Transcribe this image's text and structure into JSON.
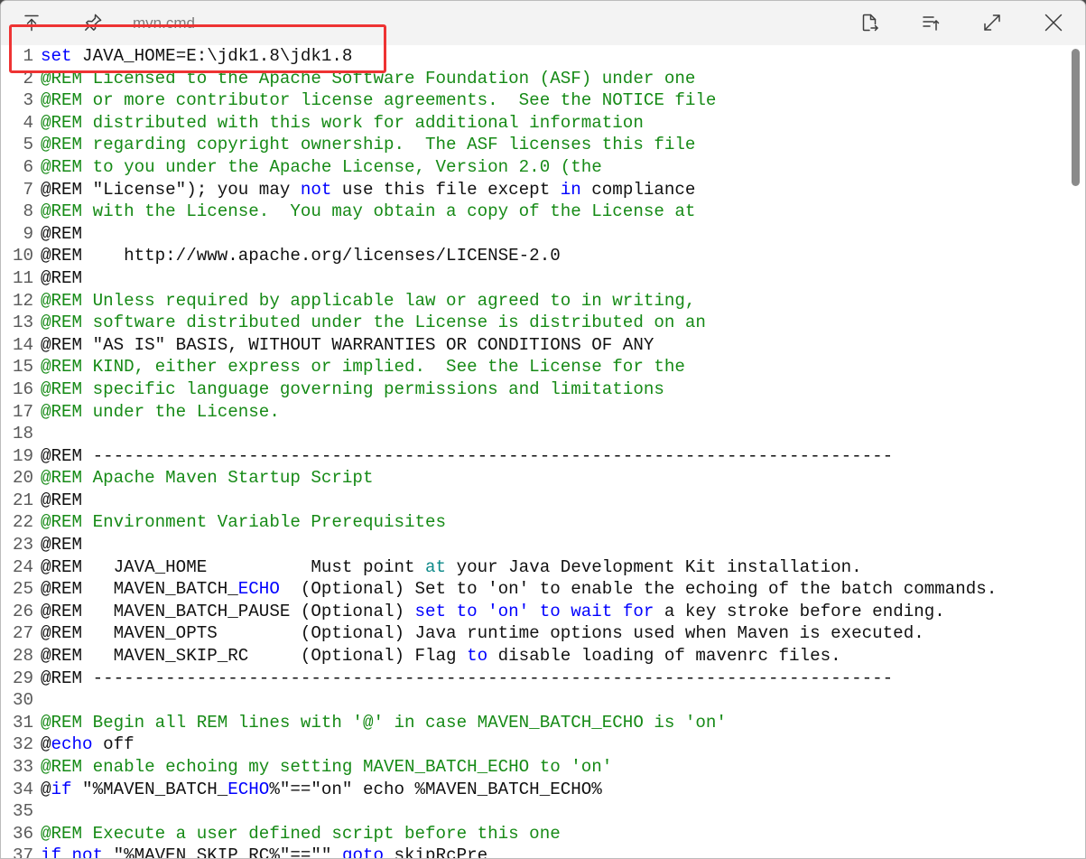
{
  "titlebar": {
    "title": "mvn.cmd",
    "left_icons": [
      "keep-on-top-icon",
      "pin-icon"
    ],
    "right_icons": [
      "open-with-icon",
      "list-icon",
      "fullscreen-icon",
      "close-icon"
    ]
  },
  "colors": {
    "keyword": "#0000ff",
    "comment": "#168a16",
    "label": "#0e8a8a",
    "text": "#111111",
    "line_number": "#5a5a5a",
    "annotation": "#ee3333"
  },
  "editor": {
    "scrollbar": {
      "position": 0,
      "visible_fraction": 0.17
    },
    "lines": [
      {
        "n": 1,
        "tokens": [
          {
            "t": "set",
            "k": "kw"
          },
          {
            "t": " JAVA_HOME=E:\\jdk1.8\\jdk1.8",
            "k": "tx"
          }
        ]
      },
      {
        "n": 2,
        "tokens": [
          {
            "t": "@REM Licensed to the Apache Software Foundation (ASF) under one",
            "k": "cm"
          }
        ]
      },
      {
        "n": 3,
        "tokens": [
          {
            "t": "@REM or more contributor license agreements.  See the NOTICE file",
            "k": "cm"
          }
        ]
      },
      {
        "n": 4,
        "tokens": [
          {
            "t": "@REM distributed with this work for additional information",
            "k": "cm"
          }
        ]
      },
      {
        "n": 5,
        "tokens": [
          {
            "t": "@REM regarding copyright ownership.  The ASF licenses this file",
            "k": "cm"
          }
        ]
      },
      {
        "n": 6,
        "tokens": [
          {
            "t": "@REM to you under the Apache License, Version 2.0 (the",
            "k": "cm"
          }
        ]
      },
      {
        "n": 7,
        "tokens": [
          {
            "t": "@REM \"License\"); you may ",
            "k": "tx"
          },
          {
            "t": "not",
            "k": "kw"
          },
          {
            "t": " use this file except ",
            "k": "tx"
          },
          {
            "t": "in",
            "k": "kw"
          },
          {
            "t": " compliance",
            "k": "tx"
          }
        ]
      },
      {
        "n": 8,
        "tokens": [
          {
            "t": "@REM with the License.  You may obtain a copy of the License at",
            "k": "cm"
          }
        ]
      },
      {
        "n": 9,
        "tokens": [
          {
            "t": "@REM",
            "k": "tx"
          }
        ]
      },
      {
        "n": 10,
        "tokens": [
          {
            "t": "@REM    http://www.apache.org/licenses/LICENSE-2.0",
            "k": "tx"
          }
        ]
      },
      {
        "n": 11,
        "tokens": [
          {
            "t": "@REM",
            "k": "tx"
          }
        ]
      },
      {
        "n": 12,
        "tokens": [
          {
            "t": "@REM Unless required by applicable law or agreed to in writing,",
            "k": "cm"
          }
        ]
      },
      {
        "n": 13,
        "tokens": [
          {
            "t": "@REM software distributed under the License is distributed on an",
            "k": "cm"
          }
        ]
      },
      {
        "n": 14,
        "tokens": [
          {
            "t": "@REM \"AS IS\" BASIS, WITHOUT WARRANTIES OR CONDITIONS OF ANY",
            "k": "tx"
          }
        ]
      },
      {
        "n": 15,
        "tokens": [
          {
            "t": "@REM KIND, either express or implied.  See the License for the",
            "k": "cm"
          }
        ]
      },
      {
        "n": 16,
        "tokens": [
          {
            "t": "@REM specific language governing permissions and limitations",
            "k": "cm"
          }
        ]
      },
      {
        "n": 17,
        "tokens": [
          {
            "t": "@REM under the License.",
            "k": "cm"
          }
        ]
      },
      {
        "n": 18,
        "tokens": []
      },
      {
        "n": 19,
        "tokens": [
          {
            "t": "@REM -----------------------------------------------------------------------------",
            "k": "tx"
          }
        ]
      },
      {
        "n": 20,
        "tokens": [
          {
            "t": "@REM Apache Maven Startup Script",
            "k": "cm"
          }
        ]
      },
      {
        "n": 21,
        "tokens": [
          {
            "t": "@REM",
            "k": "tx"
          }
        ]
      },
      {
        "n": 22,
        "tokens": [
          {
            "t": "@REM Environment Variable Prerequisites",
            "k": "cm"
          }
        ]
      },
      {
        "n": 23,
        "tokens": [
          {
            "t": "@REM",
            "k": "tx"
          }
        ]
      },
      {
        "n": 24,
        "tokens": [
          {
            "t": "@REM   JAVA_HOME          Must point ",
            "k": "tx"
          },
          {
            "t": "at",
            "k": "lb"
          },
          {
            "t": " your Java Development Kit installation.",
            "k": "tx"
          }
        ]
      },
      {
        "n": 25,
        "tokens": [
          {
            "t": "@REM   MAVEN_BATCH_",
            "k": "tx"
          },
          {
            "t": "ECHO",
            "k": "kw"
          },
          {
            "t": "  (Optional) Set to 'on' to enable the echoing of the batch commands.",
            "k": "tx"
          }
        ]
      },
      {
        "n": 26,
        "tokens": [
          {
            "t": "@REM   MAVEN_BATCH_PAUSE (Optional) ",
            "k": "tx"
          },
          {
            "t": "set to 'on' to wait for",
            "k": "kw"
          },
          {
            "t": " a key stroke before ending.",
            "k": "tx"
          }
        ]
      },
      {
        "n": 27,
        "tokens": [
          {
            "t": "@REM   MAVEN_OPTS        (Optional) Java runtime options used when Maven is executed.",
            "k": "tx"
          }
        ]
      },
      {
        "n": 28,
        "tokens": [
          {
            "t": "@REM   MAVEN_SKIP_RC     (Optional) Flag ",
            "k": "tx"
          },
          {
            "t": "to",
            "k": "kw"
          },
          {
            "t": " disable loading of mavenrc files.",
            "k": "tx"
          }
        ]
      },
      {
        "n": 29,
        "tokens": [
          {
            "t": "@REM -----------------------------------------------------------------------------",
            "k": "tx"
          }
        ]
      },
      {
        "n": 30,
        "tokens": []
      },
      {
        "n": 31,
        "tokens": [
          {
            "t": "@REM Begin all REM lines with '@' in case MAVEN_BATCH_ECHO is 'on'",
            "k": "cm"
          }
        ]
      },
      {
        "n": 32,
        "tokens": [
          {
            "t": "@",
            "k": "tx"
          },
          {
            "t": "echo",
            "k": "kw"
          },
          {
            "t": " off",
            "k": "tx"
          }
        ]
      },
      {
        "n": 33,
        "tokens": [
          {
            "t": "@REM enable echoing my setting MAVEN_BATCH_ECHO to 'on'",
            "k": "cm"
          }
        ]
      },
      {
        "n": 34,
        "tokens": [
          {
            "t": "@",
            "k": "tx"
          },
          {
            "t": "if",
            "k": "kw"
          },
          {
            "t": " \"%MAVEN_BATCH_",
            "k": "tx"
          },
          {
            "t": "ECHO",
            "k": "kw"
          },
          {
            "t": "%\"==\"on\" echo %MAVEN_BATCH_ECHO%",
            "k": "tx"
          }
        ]
      },
      {
        "n": 35,
        "tokens": []
      },
      {
        "n": 36,
        "tokens": [
          {
            "t": "@REM Execute a user defined script before this one",
            "k": "cm"
          }
        ]
      },
      {
        "n": 37,
        "tokens": [
          {
            "t": "if",
            "k": "kw"
          },
          {
            "t": " ",
            "k": "tx"
          },
          {
            "t": "not",
            "k": "kw"
          },
          {
            "t": " \"%MAVEN_SKIP_RC%\"==\"\" ",
            "k": "tx"
          },
          {
            "t": "goto",
            "k": "kw"
          },
          {
            "t": " skipRcPre",
            "k": "tx"
          }
        ]
      }
    ]
  }
}
